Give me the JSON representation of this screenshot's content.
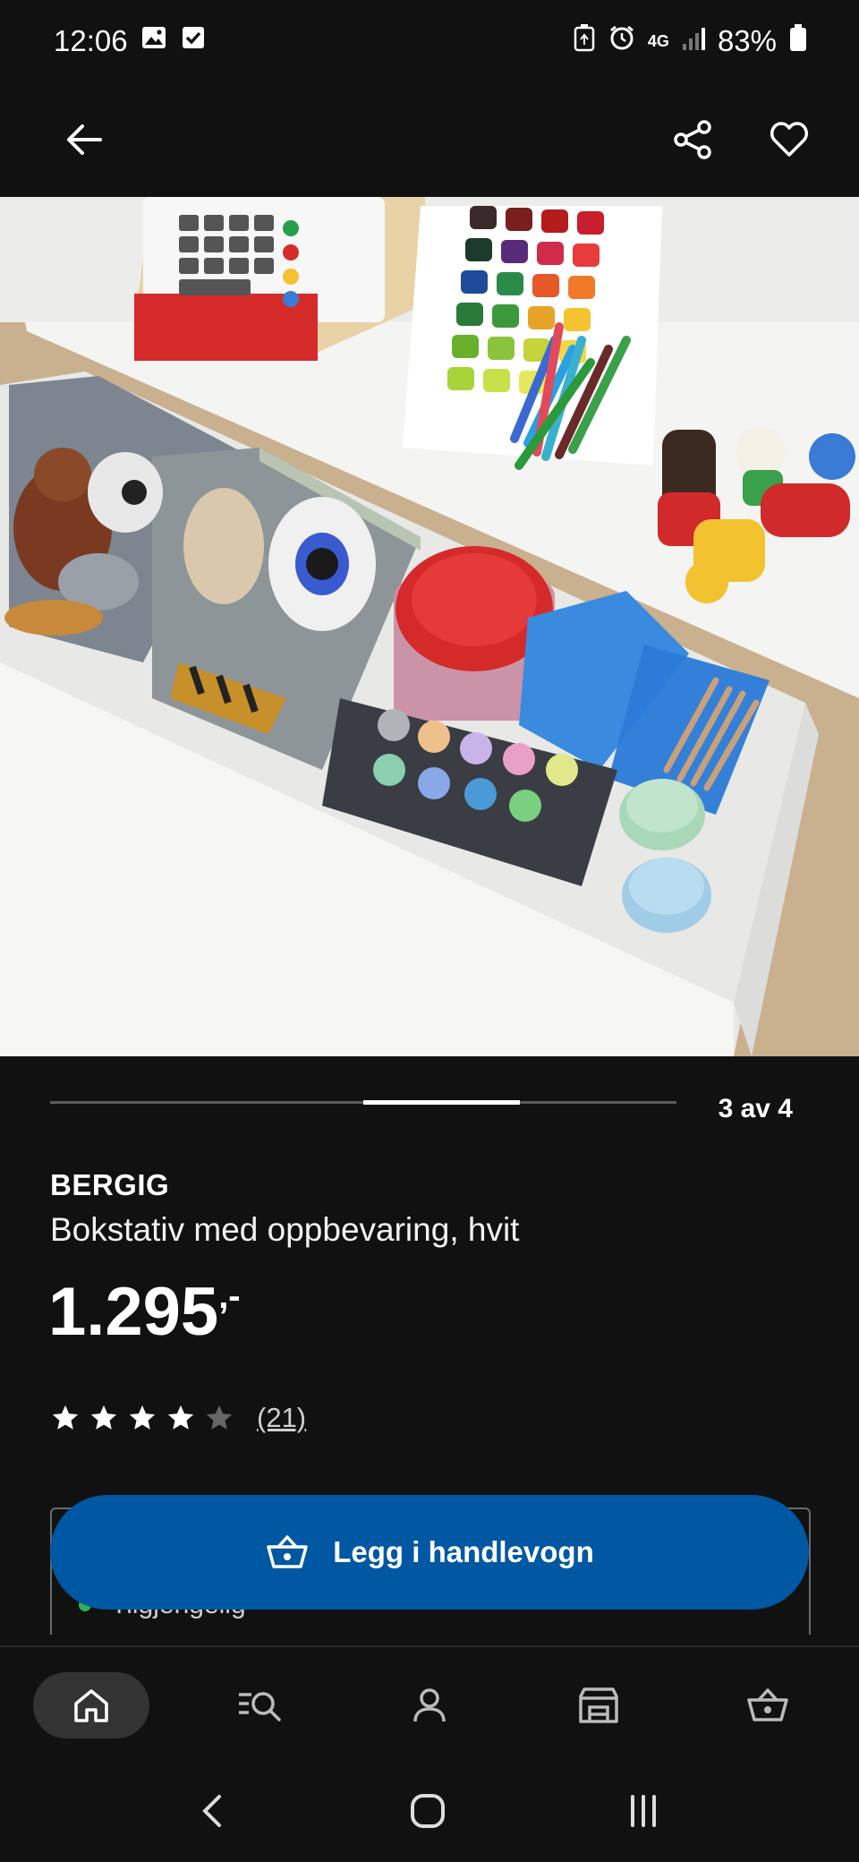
{
  "status": {
    "time": "12:06",
    "battery": "83%",
    "network": "4G"
  },
  "app_bar": {
    "back_icon": "arrow-left-icon",
    "share_icon": "share-icon",
    "favorite_icon": "heart-icon"
  },
  "hero": {
    "subject": "white storage box"
  },
  "carousel": {
    "current": 3,
    "total": 4,
    "label": "3 av 4"
  },
  "product": {
    "brand": "BERGIG",
    "description": "Bokstativ med oppbevaring, hvit",
    "price": "1.295",
    "price_suffix": ",-",
    "rating": 4,
    "rating_max": 5,
    "review_count": "(21)"
  },
  "availability": {
    "text": "Tilgjengelig",
    "status_color": "#2bb356"
  },
  "cart_button": {
    "label": "Legg i handlevogn",
    "icon": "basket-icon",
    "color": "#0058a3"
  },
  "bottom_nav": [
    {
      "name": "home",
      "icon": "home-icon",
      "active": true
    },
    {
      "name": "search",
      "icon": "search-list-icon",
      "active": false
    },
    {
      "name": "profile",
      "icon": "person-icon",
      "active": false
    },
    {
      "name": "store",
      "icon": "store-icon",
      "active": false
    },
    {
      "name": "cart",
      "icon": "basket-icon",
      "active": false
    }
  ],
  "system_nav": [
    "back-icon",
    "home-circle-icon",
    "recents-icon"
  ]
}
